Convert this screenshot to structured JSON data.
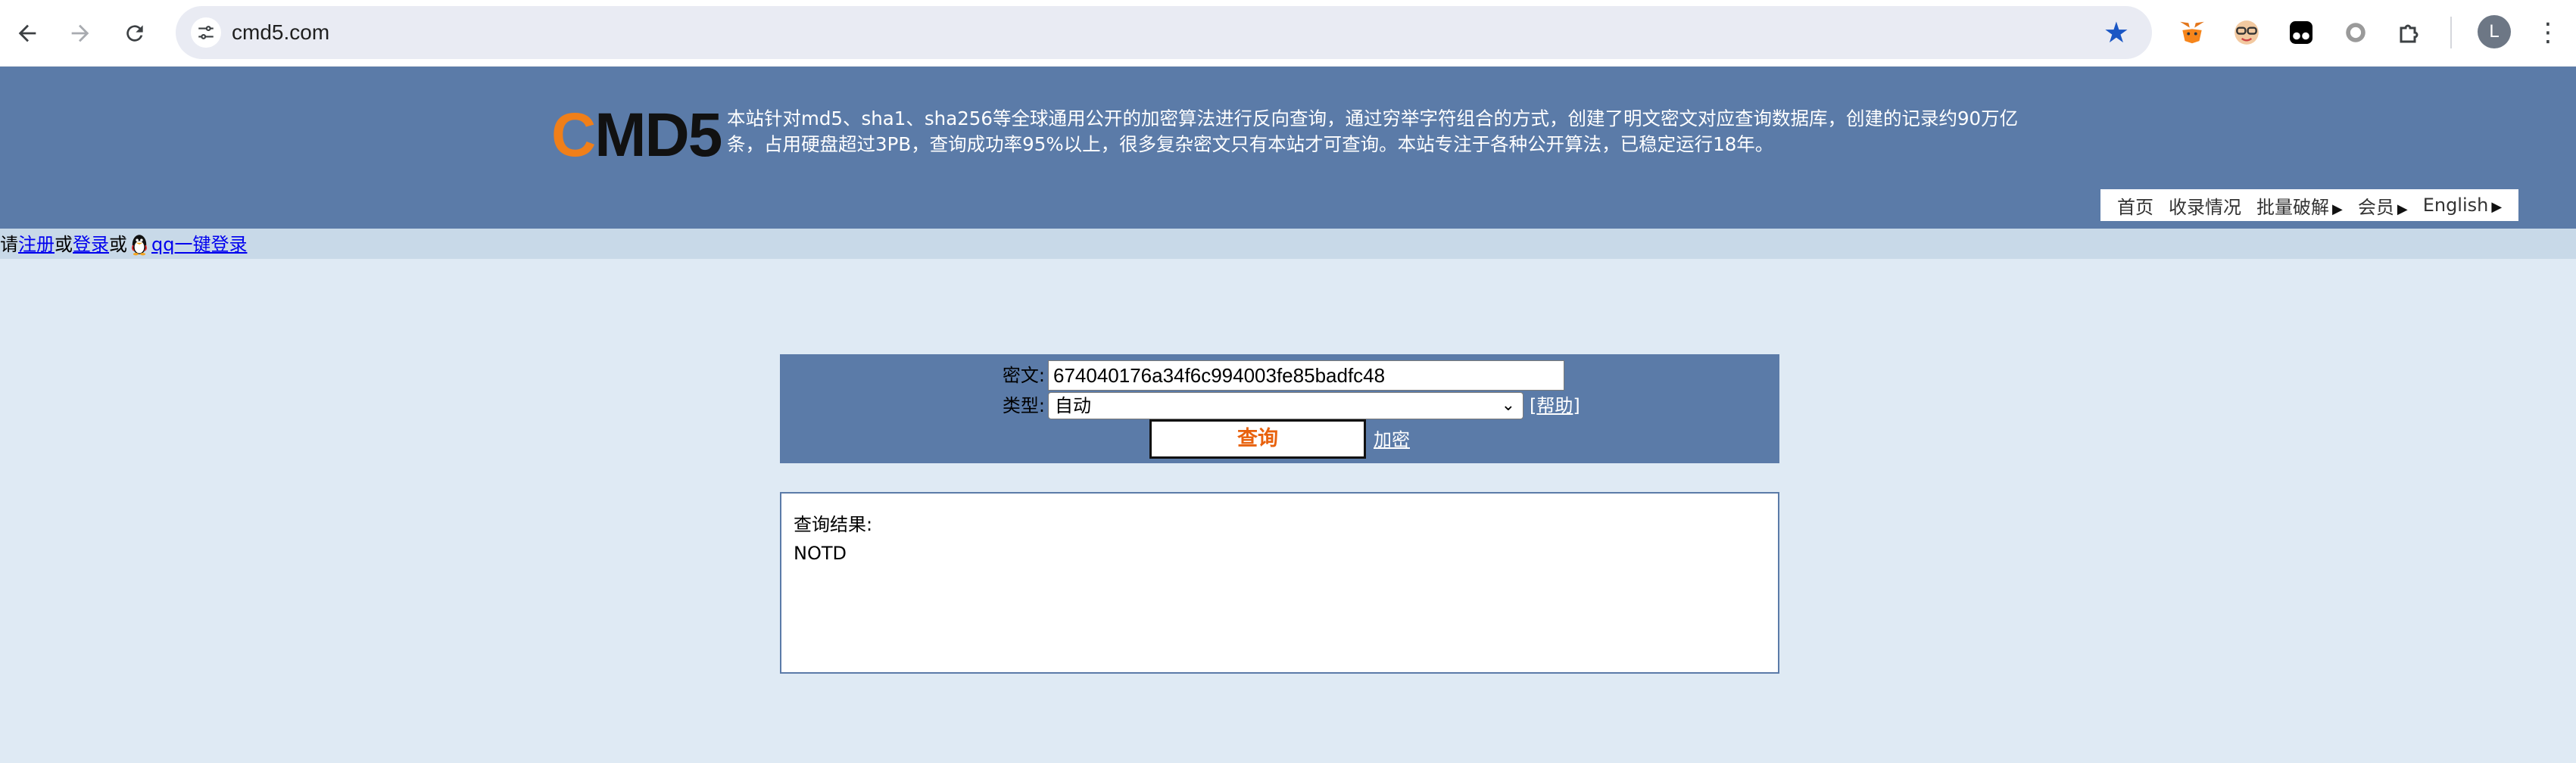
{
  "browser": {
    "url": "cmd5.com",
    "back_icon": "arrow-left",
    "forward_icon": "arrow-right",
    "reload_icon": "reload",
    "extensions": [
      "metamask-fox-icon",
      "glasses-face-icon",
      "tampermonkey-icon",
      "circle-extension-icon",
      "puzzle-extensions-icon"
    ],
    "profile_initial": "L"
  },
  "header": {
    "logo_first": "C",
    "logo_rest": "MD5",
    "intro": "本站针对md5、sha1、sha256等全球通用公开的加密算法进行反向查询，通过穷举字符组合的方式，创建了明文密文对应查询数据库，创建的记录约90万亿条，占用硬盘超过3PB，查询成功率95%以上，很多复杂密文只有本站才可查询。本站专注于各种公开算法，已稳定运行18年。",
    "nav": [
      "首页",
      "收录情况",
      "批量破解",
      "会员",
      "English"
    ]
  },
  "login": {
    "prefix": "请",
    "register": "注册",
    "or1": "或",
    "login": "登录",
    "or2": "或",
    "qq_login": "qq一键登录"
  },
  "query": {
    "cipher_label": "密文:",
    "cipher_value": "674040176a34f6c994003fe85badfc48",
    "type_label": "类型:",
    "type_value": "自动",
    "help": "[帮助]",
    "help_link": "帮助",
    "submit": "查询",
    "encrypt": "加密"
  },
  "result": {
    "title": "查询结果:",
    "value": "NOTD"
  },
  "colors": {
    "header_bg": "#5b7ba8",
    "page_bg": "#dfeaf4",
    "login_bar_bg": "#c8d9e8",
    "logo_accent": "#f07f19",
    "submit_text": "#e8620e"
  }
}
